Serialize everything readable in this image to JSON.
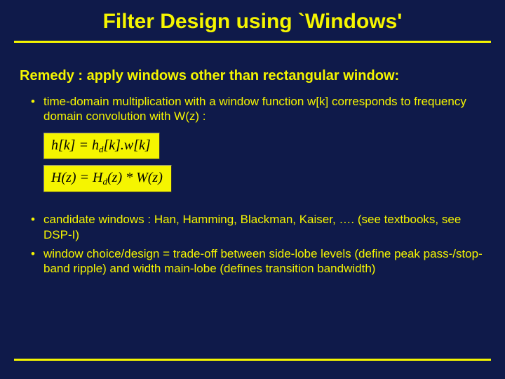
{
  "title": "Filter Design using `Windows'",
  "remedy": "Remedy : apply windows other than rectangular window:",
  "bullets": {
    "b1": "time-domain multiplication with a window function w[k] corresponds to frequency domain convolution  with W(z) :",
    "b2": "candidate windows : Han, Hamming, Blackman, Kaiser, …. (see textbooks, see DSP-I)",
    "b3": "window choice/design = trade-off between side-lobe levels (define peak pass-/stop-band ripple) and width main-lobe (defines transition bandwidth)"
  },
  "equations": {
    "eq1": {
      "lhs": "h[k]",
      "rhs_a": "h",
      "rhs_a_sub": "d",
      "rhs_a_tail": "[k].",
      "rhs_b": "w[k]"
    },
    "eq2": {
      "lhs": "H(z)",
      "rhs_a": "H",
      "rhs_a_sub": "d",
      "rhs_a_tail": "(z) * ",
      "rhs_b": "W(z)"
    }
  }
}
